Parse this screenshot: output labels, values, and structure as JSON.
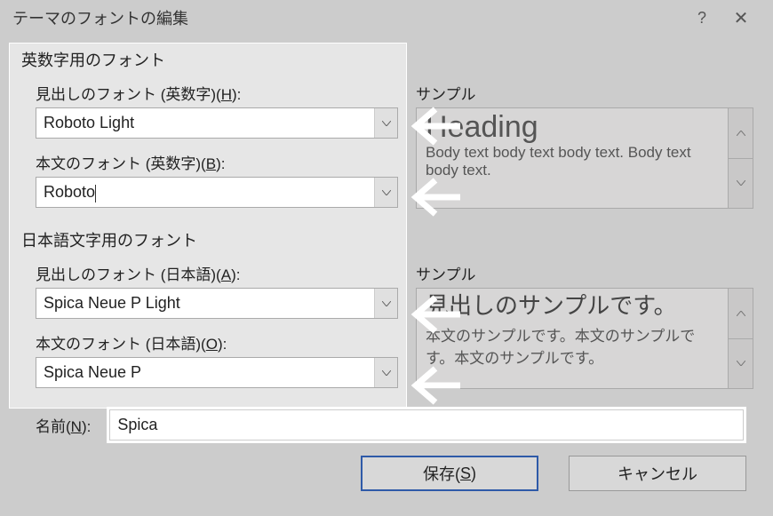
{
  "dialog": {
    "title": "テーマのフォントの編集",
    "help": "?",
    "close": "✕"
  },
  "latin": {
    "section_title": "英数字用のフォント",
    "heading_label_prefix": "見出しのフォント (英数字)(",
    "heading_hotkey": "H",
    "heading_label_suffix": "):",
    "heading_value": "Roboto Light",
    "body_label_prefix": "本文のフォント (英数字)(",
    "body_hotkey": "B",
    "body_label_suffix": "):",
    "body_value": "Roboto",
    "sample_label": "サンプル",
    "sample_heading": "Heading",
    "sample_body": "Body text body text body text. Body text body text."
  },
  "jp": {
    "section_title": "日本語文字用のフォント",
    "heading_label_prefix": "見出しのフォント (日本語)(",
    "heading_hotkey": "A",
    "heading_label_suffix": "):",
    "heading_value": "Spica Neue P Light",
    "body_label_prefix": "本文のフォント (日本語)(",
    "body_hotkey": "O",
    "body_label_suffix": "):",
    "body_value": "Spica Neue P",
    "sample_label": "サンプル",
    "sample_heading": "見出しのサンプルです。",
    "sample_body": "本文のサンプルです。本文のサンプルです。本文のサンプルです。"
  },
  "name": {
    "label_prefix": "名前(",
    "hotkey": "N",
    "label_suffix": "):",
    "value": "Spica"
  },
  "buttons": {
    "save_prefix": "保存(",
    "save_hotkey": "S",
    "save_suffix": ")",
    "cancel": "キャンセル"
  }
}
